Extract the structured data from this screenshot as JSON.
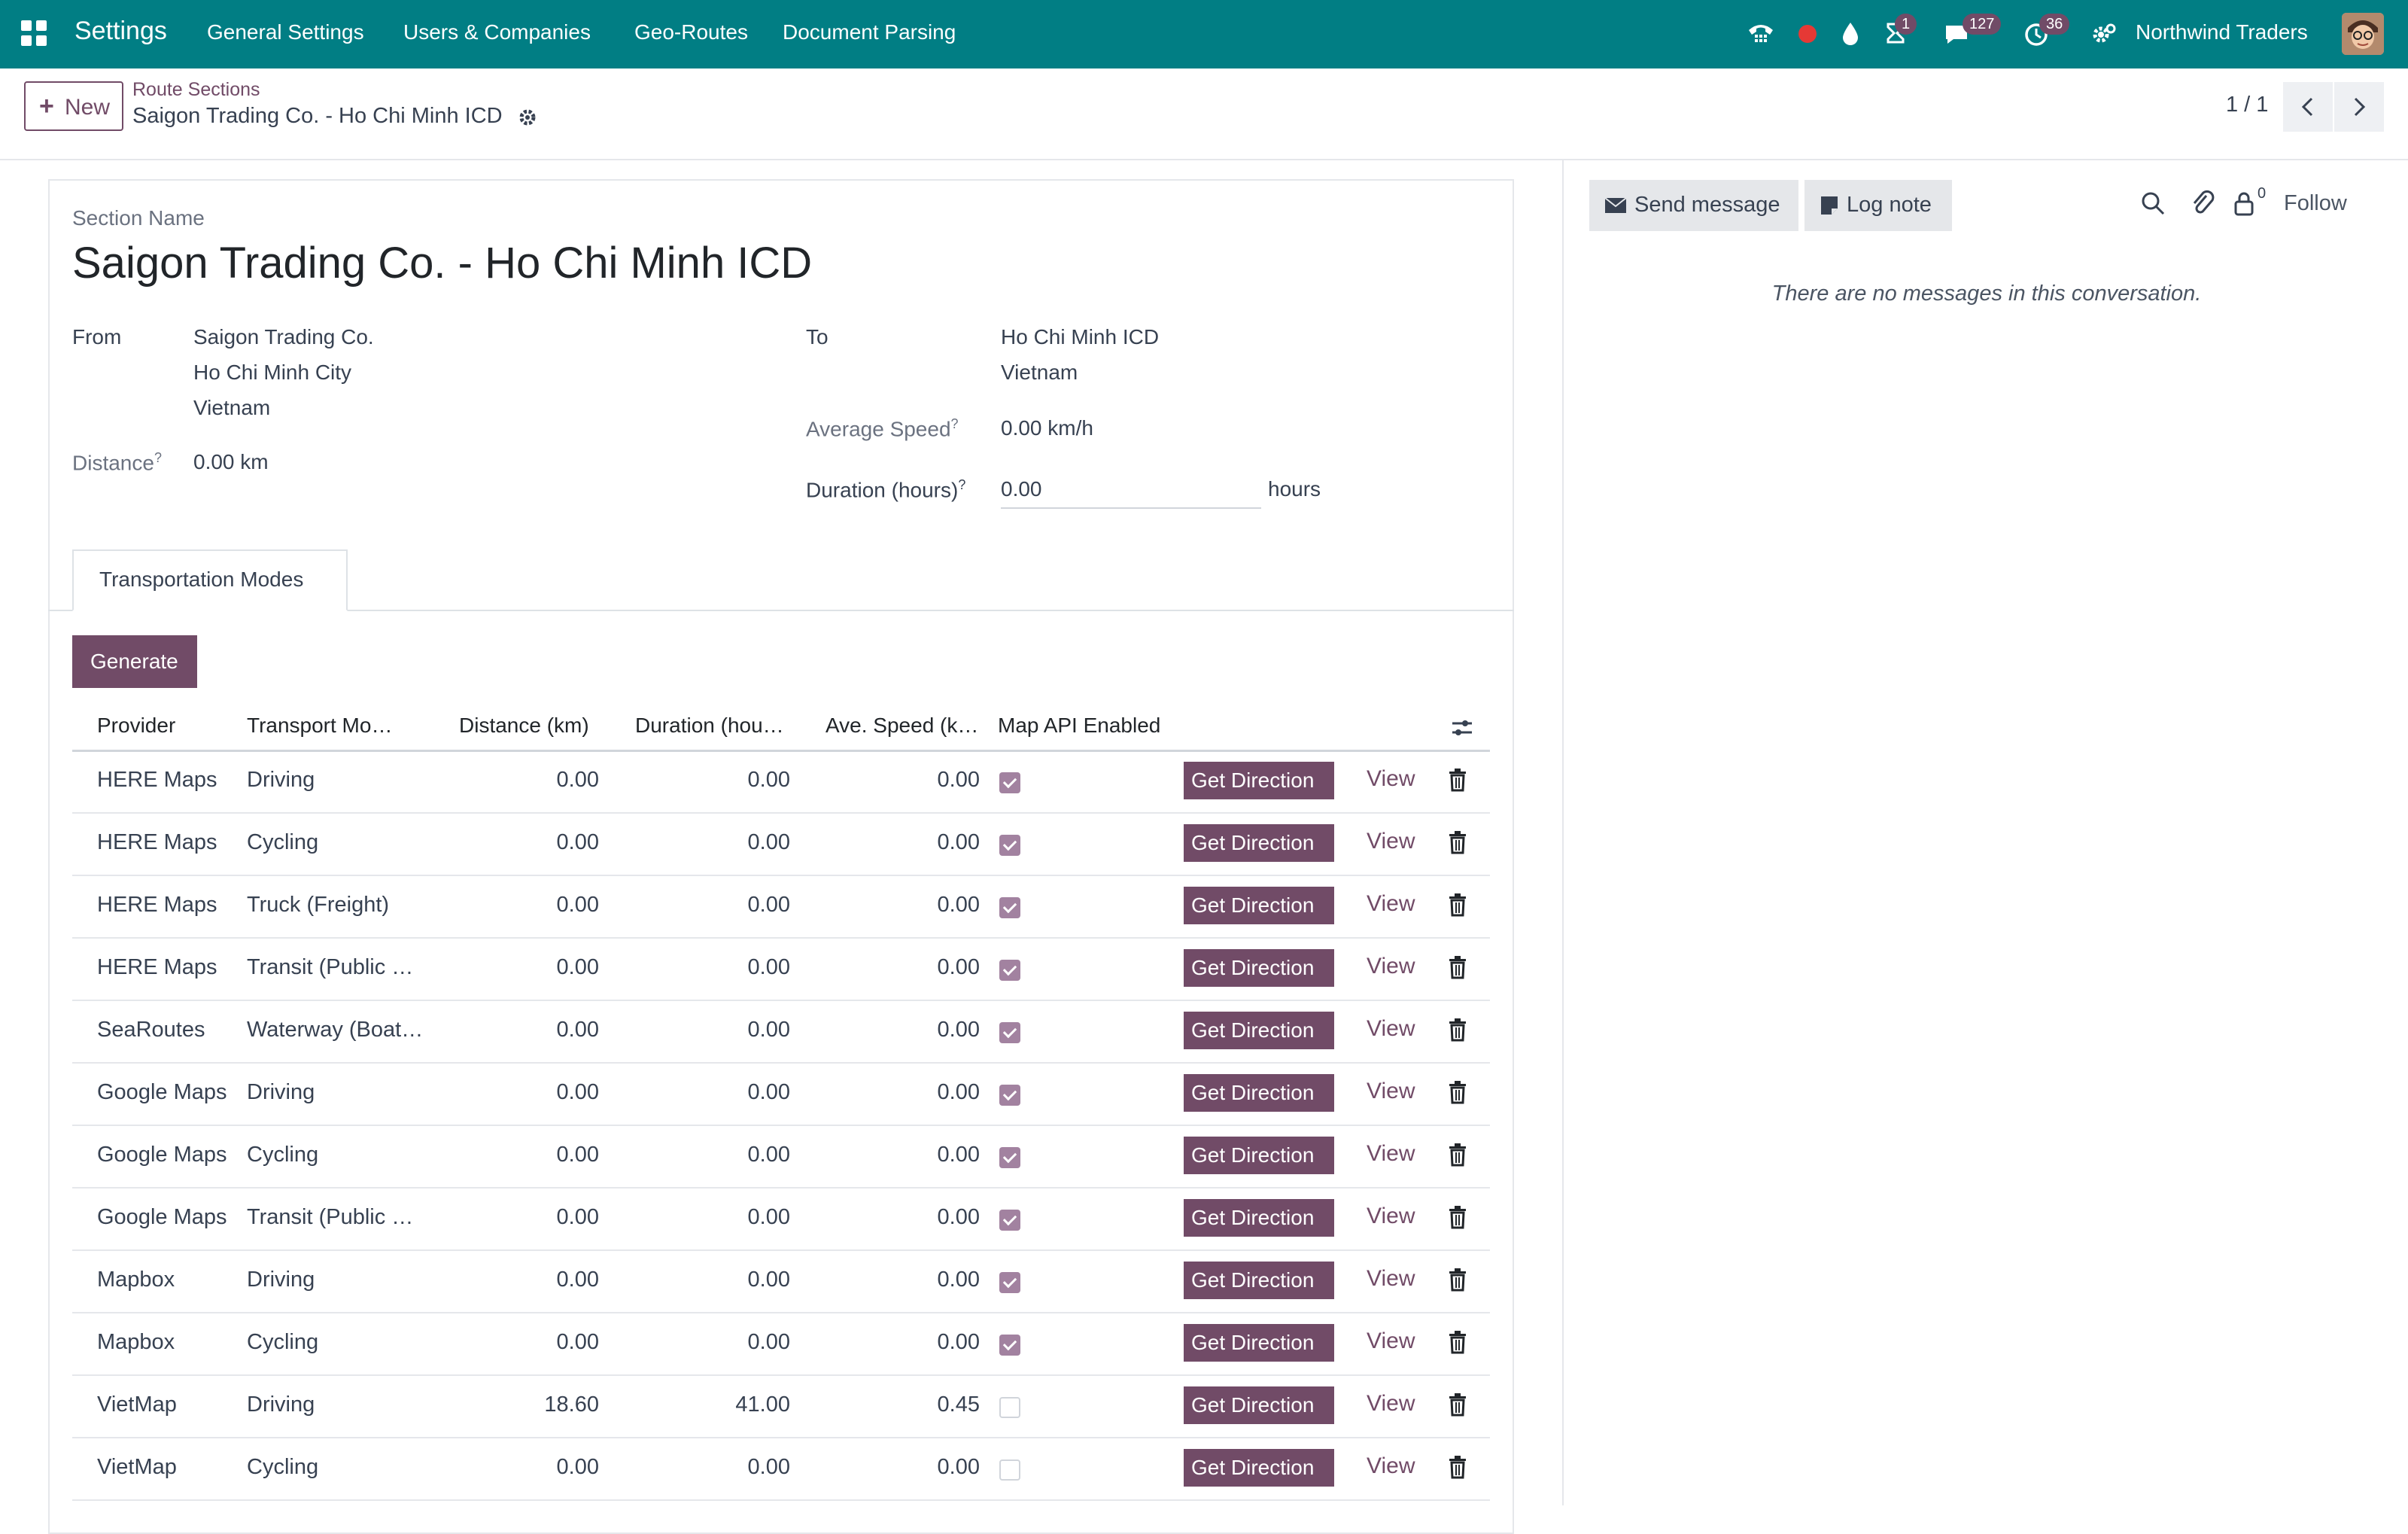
{
  "navbar": {
    "app_name": "Settings",
    "menu": [
      "General Settings",
      "Users & Companies",
      "Geo-Routes",
      "Document Parsing"
    ],
    "badges": {
      "activity": "1",
      "messages": "127",
      "clock": "36"
    },
    "company": "Northwind Traders",
    "icons": [
      "phone-icon",
      "recording-dot-icon",
      "drop-icon",
      "hourglass-icon",
      "chat-icon",
      "clock-icon",
      "settings-icon"
    ],
    "colors": {
      "bar": "#017e84",
      "badge": "#714b67",
      "record": "#e53935"
    }
  },
  "control_panel": {
    "new_label": "New",
    "breadcrumb_parent": "Route Sections",
    "breadcrumb_current": "Saigon Trading Co. - Ho Chi Minh ICD",
    "pager": "1 / 1"
  },
  "form": {
    "section_name_label": "Section Name",
    "section_name": "Saigon Trading Co. - Ho Chi Minh ICD",
    "from_label": "From",
    "from_lines": [
      "Saigon Trading Co.",
      "Ho Chi Minh City",
      "Vietnam"
    ],
    "to_label": "To",
    "to_lines": [
      "Ho Chi Minh ICD",
      "Vietnam"
    ],
    "distance_label": "Distance",
    "distance_value": "0.00 km",
    "avg_speed_label": "Average Speed",
    "avg_speed_value": "0.00 km/h",
    "duration_label": "Duration (hours)",
    "duration_value": "0.00",
    "duration_unit": "hours",
    "help_mark": "?",
    "tab_label": "Transportation Modes",
    "generate_label": "Generate"
  },
  "table": {
    "headers": [
      "Provider",
      "Transport Mo…",
      "Distance (km)",
      "Duration (hou…",
      "Ave. Speed (k…",
      "Map API Enabled"
    ],
    "action_label": "Get Direction",
    "view_label": "View",
    "rows": [
      {
        "provider": "HERE Maps",
        "mode": "Driving",
        "distance": "0.00",
        "duration": "0.00",
        "speed": "0.00",
        "api": true
      },
      {
        "provider": "HERE Maps",
        "mode": "Cycling",
        "distance": "0.00",
        "duration": "0.00",
        "speed": "0.00",
        "api": true
      },
      {
        "provider": "HERE Maps",
        "mode": "Truck (Freight)",
        "distance": "0.00",
        "duration": "0.00",
        "speed": "0.00",
        "api": true
      },
      {
        "provider": "HERE Maps",
        "mode": "Transit (Public …",
        "distance": "0.00",
        "duration": "0.00",
        "speed": "0.00",
        "api": true
      },
      {
        "provider": "SeaRoutes",
        "mode": "Waterway (Boat…",
        "distance": "0.00",
        "duration": "0.00",
        "speed": "0.00",
        "api": true
      },
      {
        "provider": "Google Maps",
        "mode": "Driving",
        "distance": "0.00",
        "duration": "0.00",
        "speed": "0.00",
        "api": true
      },
      {
        "provider": "Google Maps",
        "mode": "Cycling",
        "distance": "0.00",
        "duration": "0.00",
        "speed": "0.00",
        "api": true
      },
      {
        "provider": "Google Maps",
        "mode": "Transit (Public …",
        "distance": "0.00",
        "duration": "0.00",
        "speed": "0.00",
        "api": true
      },
      {
        "provider": "Mapbox",
        "mode": "Driving",
        "distance": "0.00",
        "duration": "0.00",
        "speed": "0.00",
        "api": true
      },
      {
        "provider": "Mapbox",
        "mode": "Cycling",
        "distance": "0.00",
        "duration": "0.00",
        "speed": "0.00",
        "api": true
      },
      {
        "provider": "VietMap",
        "mode": "Driving",
        "distance": "18.60",
        "duration": "41.00",
        "speed": "0.45",
        "api": false
      },
      {
        "provider": "VietMap",
        "mode": "Cycling",
        "distance": "0.00",
        "duration": "0.00",
        "speed": "0.00",
        "api": false
      }
    ]
  },
  "chatter": {
    "send_message": "Send message",
    "log_note": "Log note",
    "followers_count": "0",
    "follow": "Follow",
    "empty_text": "There are no messages in this conversation."
  }
}
